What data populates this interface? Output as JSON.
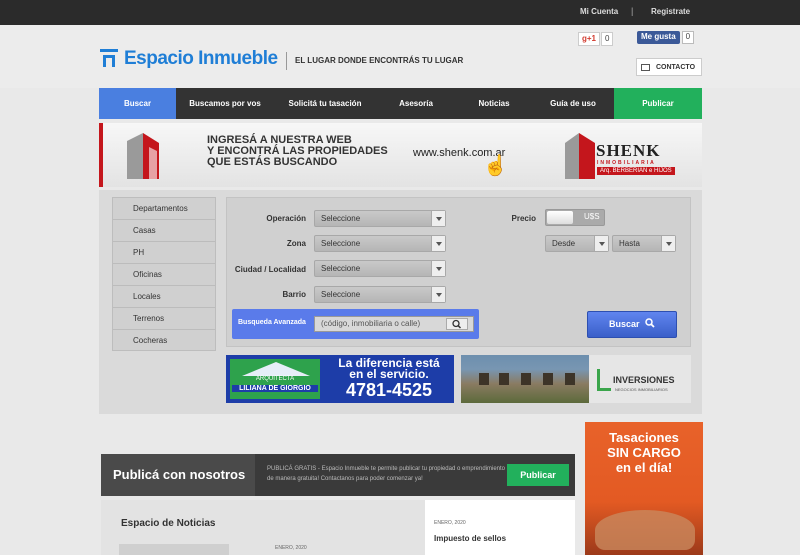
{
  "topbar": {
    "account": "Mi Cuenta",
    "separator": "|",
    "register": "Registrate"
  },
  "header": {
    "logo_text": "Espacio Inmueble",
    "tagline": "EL LUGAR DONDE ENCONTRÁS TU LUGAR",
    "gplus_label": "g+1",
    "gplus_count": "0",
    "fb_label": "Me gusta",
    "fb_count": "0",
    "contact_label": "CONTACTO"
  },
  "nav": {
    "items": [
      {
        "label": "Buscar"
      },
      {
        "label": "Buscamos por vos"
      },
      {
        "label": "Solicitá tu tasación"
      },
      {
        "label": "Asesoría"
      },
      {
        "label": "Noticias"
      },
      {
        "label": "Guía de uso"
      },
      {
        "label": "Publicar"
      }
    ],
    "colors": {
      "active": "#4a7fe0",
      "default": "#333333",
      "publish": "#22b05c"
    }
  },
  "banner_shenk": {
    "line1": "INGRESÁ A NUESTRA WEB",
    "line2": "Y ENCONTRÁ LAS PROPIEDADES",
    "line3": "QUE ESTÁS BUSCANDO",
    "url": "www.shenk.com.ar",
    "brand": "SHENK",
    "brand_sub": "INMOBILIARIA",
    "brand_sub2": "Arq. BERBERIAN e HIJOS"
  },
  "categories": [
    "Departamentos",
    "Casas",
    "PH",
    "Oficinas",
    "Locales",
    "Terrenos",
    "Cocheras"
  ],
  "search": {
    "operation_label": "Operación",
    "operation_value": "Seleccione",
    "zone_label": "Zona",
    "zone_value": "Seleccione",
    "city_label": "Ciudad / Localidad",
    "city_value": "Seleccione",
    "barrio_label": "Barrio",
    "barrio_value": "Seleccione",
    "price_label": "Precio",
    "currency": "U$S",
    "from_value": "Desde",
    "to_value": "Hasta",
    "advanced_label": "Busqueda Avanzada",
    "advanced_placeholder": "(código, inmobiliaria o calle)",
    "search_button": "Buscar"
  },
  "banner_arq": {
    "logo_top": "ARQUITECTA",
    "logo_name": "LILIANA DE GIORGIO",
    "line1": "La diferencia está",
    "line2": "en el servicio.",
    "phone": "4781-4525"
  },
  "banner_inv": {
    "brand": "INVERSIONES",
    "sub": "NEGOCIOS INMOBILIARIOS"
  },
  "publica": {
    "title": "Publicá con nosotros",
    "desc": "PUBLICÁ GRATIS - Espacio Inmueble te permite publicar tu propiedad o emprendimiento de manera gratuita! Contactanos para poder comenzar ya!",
    "button": "Publicar"
  },
  "news": {
    "title": "Espacio de Noticias",
    "date1": "ENERO, 2020",
    "date2": "ENERO, 2020",
    "headline2": "Impuesto de sellos"
  },
  "tasaciones": {
    "line1": "Tasaciones",
    "line2": "SIN CARGO",
    "line3": "en el día!"
  }
}
